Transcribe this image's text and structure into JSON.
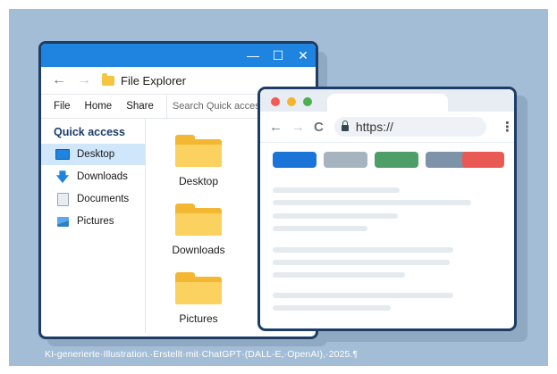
{
  "caption": "KI-generierte·Illustration.·Erstellt·mit·ChatGPT·(DALL-E,·OpenAI),·2025.¶",
  "colors": {
    "background": "#a3bdd6",
    "window_border": "#1e3d66",
    "explorer_titlebar": "#1e84e0",
    "folder": "#fbd160"
  },
  "explorer": {
    "window_controls": [
      "—",
      "☐",
      "✕"
    ],
    "back_icon": "←",
    "forward_icon": "→",
    "title": "File Explorer",
    "menu": [
      "File",
      "Home",
      "Share"
    ],
    "search_placeholder": "Search Quick access",
    "sidebar": {
      "heading": "Quick access",
      "items": [
        {
          "label": "Desktop",
          "icon": "desktop-icon",
          "active": true
        },
        {
          "label": "Downloads",
          "icon": "download-icon",
          "active": false
        },
        {
          "label": "Documents",
          "icon": "document-icon",
          "active": false
        },
        {
          "label": "Pictures",
          "icon": "pictures-icon",
          "active": false
        }
      ]
    },
    "folders": [
      "Desktop",
      "Downloads",
      "Pictures"
    ]
  },
  "browser": {
    "traffic_lights": [
      "#f25c54",
      "#f7b32b",
      "#4caf50"
    ],
    "back_icon": "←",
    "forward_icon": "→",
    "reload_icon": "C",
    "url": "https://",
    "menu_icon": "⋮",
    "buttons": [
      {
        "color": "#1b74d8"
      },
      {
        "color": "#a6b4c0"
      },
      {
        "color": "#4e9e68"
      },
      {
        "color": "#7c93aa"
      },
      {
        "color": "#ea5a55"
      }
    ]
  }
}
